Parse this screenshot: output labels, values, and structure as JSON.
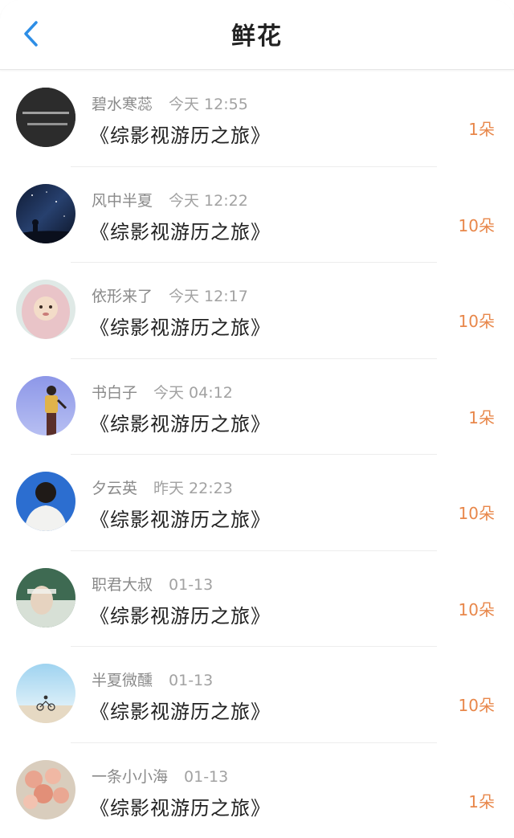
{
  "header": {
    "title": "鲜花",
    "back_icon": "chevron-left-icon",
    "accent": "#2d8ee6"
  },
  "colors": {
    "count": "#e8874a",
    "meta": "#8a8a8a",
    "work": "#222222"
  },
  "rows": [
    {
      "name": "碧水寒蕊",
      "time": "今天 12:55",
      "work": "《综影视游历之旅》",
      "count": "1朵",
      "avatar": "dark-text-avatar"
    },
    {
      "name": "风中半夏",
      "time": "今天 12:22",
      "work": "《综影视游历之旅》",
      "count": "10朵",
      "avatar": "night-sky-avatar"
    },
    {
      "name": "依形来了",
      "time": "今天 12:17",
      "work": "《综影视游历之旅》",
      "count": "10朵",
      "avatar": "baby-hood-avatar"
    },
    {
      "name": "书白子",
      "time": "今天 04:12",
      "work": "《综影视游历之旅》",
      "count": "1朵",
      "avatar": "person-blue-sky-avatar"
    },
    {
      "name": "夕云英",
      "time": "昨天 22:23",
      "work": "《综影视游历之旅》",
      "count": "10朵",
      "avatar": "boy-blue-wall-avatar"
    },
    {
      "name": "职君大叔",
      "time": "01-13",
      "work": "《综影视游历之旅》",
      "count": "10朵",
      "avatar": "green-portrait-avatar"
    },
    {
      "name": "半夏微醺",
      "time": "01-13",
      "work": "《综影视游历之旅》",
      "count": "10朵",
      "avatar": "beach-bike-avatar"
    },
    {
      "name": "一条小小海",
      "time": "01-13",
      "work": "《综影视游历之旅》",
      "count": "1朵",
      "avatar": "roses-avatar"
    }
  ]
}
